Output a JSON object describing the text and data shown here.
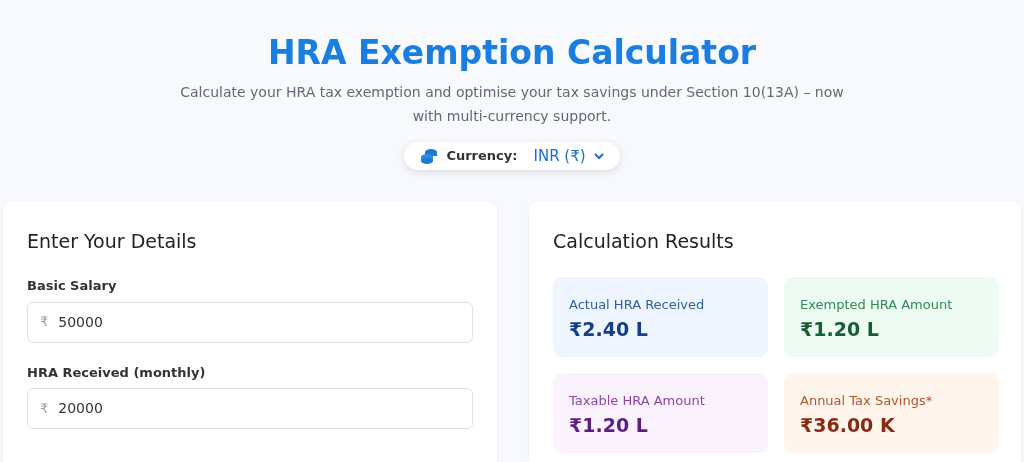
{
  "header": {
    "title": "HRA Exemption Calculator",
    "subtitle": "Calculate your HRA tax exemption and optimise your tax savings under Section 10(13A) – now with multi-currency support.",
    "currency": {
      "label": "Currency:",
      "value": "INR (₹)"
    }
  },
  "details": {
    "title": "Enter Your Details",
    "fields": [
      {
        "label": "Basic Salary",
        "prefix": "₹",
        "value": "50000"
      },
      {
        "label": "HRA Received (monthly)",
        "prefix": "₹",
        "value": "20000"
      }
    ]
  },
  "results": {
    "title": "Calculation Results",
    "cards": [
      {
        "kind": "blue",
        "label": "Actual HRA Received",
        "value": "₹2.40 L"
      },
      {
        "kind": "green",
        "label": "Exempted HRA Amount",
        "value": "₹1.20 L"
      },
      {
        "kind": "purple",
        "label": "Taxable HRA Amount",
        "value": "₹1.20 L"
      },
      {
        "kind": "orange",
        "label": "Annual Tax Savings*",
        "value": "₹36.00 K"
      }
    ]
  }
}
